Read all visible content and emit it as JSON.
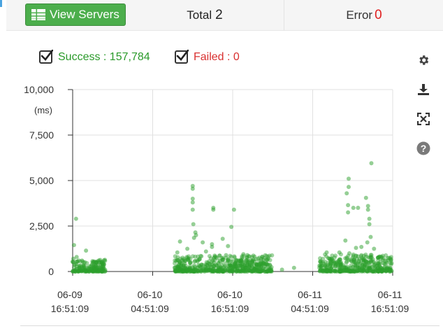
{
  "summary": {
    "view_servers_label": "View Servers",
    "total_label": "Total",
    "total_value": "2",
    "error_label": "Error",
    "error_value": "0"
  },
  "legend": {
    "success_label": "Success : 157,784",
    "failed_label": "Failed : 0",
    "success_checked": true,
    "failed_checked": true
  },
  "toolbox": {
    "icons": [
      "gear-icon",
      "download-icon",
      "fullscreen-icon",
      "help-icon"
    ]
  },
  "colors": {
    "success": "#2a9a2a",
    "failed": "#d93030",
    "button": "#4cae4c",
    "point": "#2ca02c"
  },
  "chart_data": {
    "type": "scatter",
    "ylabel": "(ms)",
    "ylim": [
      0,
      10000
    ],
    "y_ticks": [
      "0",
      "2,500",
      "5,000",
      "7,500",
      "10,000"
    ],
    "x_ticks": [
      [
        "06-09",
        "16:51:09"
      ],
      [
        "06-10",
        "04:51:09"
      ],
      [
        "06-10",
        "16:51:09"
      ],
      [
        "06-11",
        "04:51:09"
      ],
      [
        "06-11",
        "16:51:09"
      ]
    ],
    "x_range_hours": [
      0,
      48
    ],
    "grid": true,
    "series": [
      {
        "name": "Success",
        "points": [
          [
            0.2,
            1450
          ],
          [
            0.5,
            2900
          ],
          [
            2.0,
            1150
          ],
          [
            0.1,
            700
          ],
          [
            0.6,
            800
          ],
          [
            1.4,
            600
          ],
          [
            3.0,
            500
          ],
          [
            4.6,
            450
          ],
          [
            15.7,
            1050
          ],
          [
            16.1,
            1650
          ],
          [
            17.2,
            1250
          ],
          [
            17.7,
            500
          ],
          [
            18.0,
            4700
          ],
          [
            18.0,
            4550
          ],
          [
            18.0,
            4000
          ],
          [
            18.0,
            3800
          ],
          [
            18.0,
            3400
          ],
          [
            18.1,
            2600
          ],
          [
            18.2,
            1850
          ],
          [
            18.4,
            2150
          ],
          [
            18.5,
            2000
          ],
          [
            19.5,
            1600
          ],
          [
            20.0,
            1100
          ],
          [
            20.9,
            1500
          ],
          [
            20.9,
            1350
          ],
          [
            21.1,
            3500
          ],
          [
            21.1,
            3400
          ],
          [
            22.5,
            1800
          ],
          [
            23.3,
            1400
          ],
          [
            23.4,
            600
          ],
          [
            24.2,
            3400
          ],
          [
            23.8,
            2450
          ],
          [
            23.0,
            900
          ],
          [
            25.6,
            950
          ],
          [
            26.2,
            900
          ],
          [
            26.5,
            300
          ],
          [
            28.0,
            100
          ],
          [
            29.8,
            100
          ],
          [
            31.4,
            100
          ],
          [
            33.2,
            200
          ],
          [
            41.4,
            5100
          ],
          [
            41.4,
            4650
          ],
          [
            41.1,
            4300
          ],
          [
            41.3,
            3650
          ],
          [
            42.1,
            3500
          ],
          [
            42.8,
            3500
          ],
          [
            41.3,
            3250
          ],
          [
            44.0,
            4050
          ],
          [
            44.3,
            3600
          ],
          [
            44.3,
            3400
          ],
          [
            44.5,
            2900
          ],
          [
            44.5,
            2600
          ],
          [
            44.8,
            5950
          ],
          [
            40.9,
            1700
          ],
          [
            42.5,
            1300
          ],
          [
            43.3,
            1350
          ],
          [
            44.2,
            1600
          ],
          [
            44.7,
            1900
          ],
          [
            45.2,
            1250
          ],
          [
            40.0,
            1050
          ],
          [
            41.5,
            1000
          ],
          [
            38.1,
            1050
          ],
          [
            38.5,
            700
          ]
        ],
        "dense_bands": [
          {
            "x_from": 0.0,
            "x_to": 4.9,
            "y_max": 650
          },
          {
            "x_from": 15.3,
            "x_to": 29.9,
            "y_max": 900
          },
          {
            "x_from": 37.0,
            "x_to": 47.9,
            "y_max": 950
          }
        ]
      },
      {
        "name": "Failed",
        "points": []
      }
    ]
  }
}
